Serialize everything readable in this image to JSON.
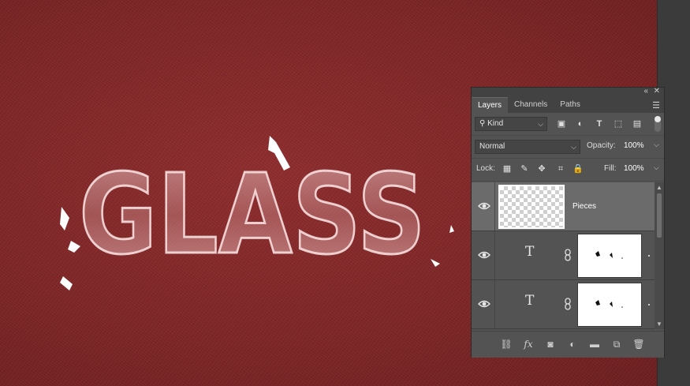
{
  "artwork": {
    "title_text": "GLASS"
  },
  "panel": {
    "tabs": [
      {
        "label": "Layers",
        "active": true
      },
      {
        "label": "Channels",
        "active": false
      },
      {
        "label": "Paths",
        "active": false
      }
    ],
    "filter": {
      "kind_label": "Kind"
    },
    "blend": {
      "mode": "Normal",
      "opacity_label": "Opacity:",
      "opacity_value": "100%"
    },
    "lock": {
      "label": "Lock:",
      "fill_label": "Fill:",
      "fill_value": "100%"
    },
    "layers": [
      {
        "name": "Pieces",
        "kind": "pixel",
        "selected": true
      },
      {
        "name": "",
        "kind": "type",
        "selected": false
      },
      {
        "name": "",
        "kind": "type",
        "selected": false
      }
    ]
  },
  "colors": {
    "canvas_bg": "#7d2324",
    "panel_bg": "#535353",
    "selected_layer": "#6b6b6b"
  },
  "icons": [
    "collapse-icon",
    "close-icon",
    "panel-menu-icon",
    "search-icon",
    "image-filter-icon",
    "adjustment-filter-icon",
    "type-filter-icon",
    "shape-filter-icon",
    "smart-object-filter-icon",
    "filter-toggle",
    "lock-transparent-icon",
    "lock-paint-icon",
    "lock-move-icon",
    "lock-artboard-icon",
    "lock-all-icon",
    "eye-icon",
    "link-layers-icon",
    "fx-icon",
    "add-mask-icon",
    "adjustment-layer-icon",
    "new-group-icon",
    "new-layer-icon",
    "trash-icon"
  ]
}
